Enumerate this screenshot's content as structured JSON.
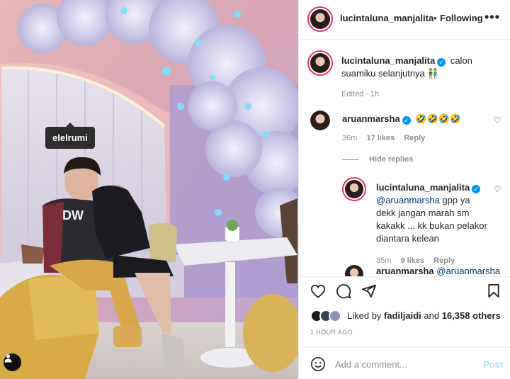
{
  "photo": {
    "tag_label": "elelrumi"
  },
  "header": {
    "username": "lucintaluna_manjalita",
    "follow_status": "Following",
    "separator": "•",
    "more": "•••"
  },
  "caption": {
    "username": "lucintaluna_manjalita",
    "text": "calon suamiku selanjutnya",
    "emoji": "👬",
    "edited": "Edited · 1h"
  },
  "comments": [
    {
      "username": "aruanmarsha",
      "text": "🤣🤣🤣🤣",
      "time": "36m",
      "likes": "17 likes",
      "reply": "Reply"
    }
  ],
  "hide_replies": "Hide replies",
  "replies": [
    {
      "username": "lucintaluna_manjalita",
      "mention": "@aruanmarsha",
      "text": " gpp ya dekk jangan marah sm kakakk ... kk bukan pelakor diantara kelean",
      "time": "35m",
      "likes": "9 likes",
      "reply": "Reply"
    }
  ],
  "partial_reply": {
    "username": "aruanmarsha",
    "mention": "@aruanmarsha"
  },
  "likes_line": {
    "prefix": "Liked by ",
    "user": "fadiljaidi",
    "middle": " and ",
    "others": "16,358 others"
  },
  "time_ago": "1 HOUR AGO",
  "comment_input": {
    "placeholder": "Add a comment...",
    "post_label": "Post"
  },
  "colors": {
    "verified": "#0095f6",
    "link": "#00376b",
    "post_disabled": "#b2dffc",
    "story_ring": "#e8306f"
  }
}
